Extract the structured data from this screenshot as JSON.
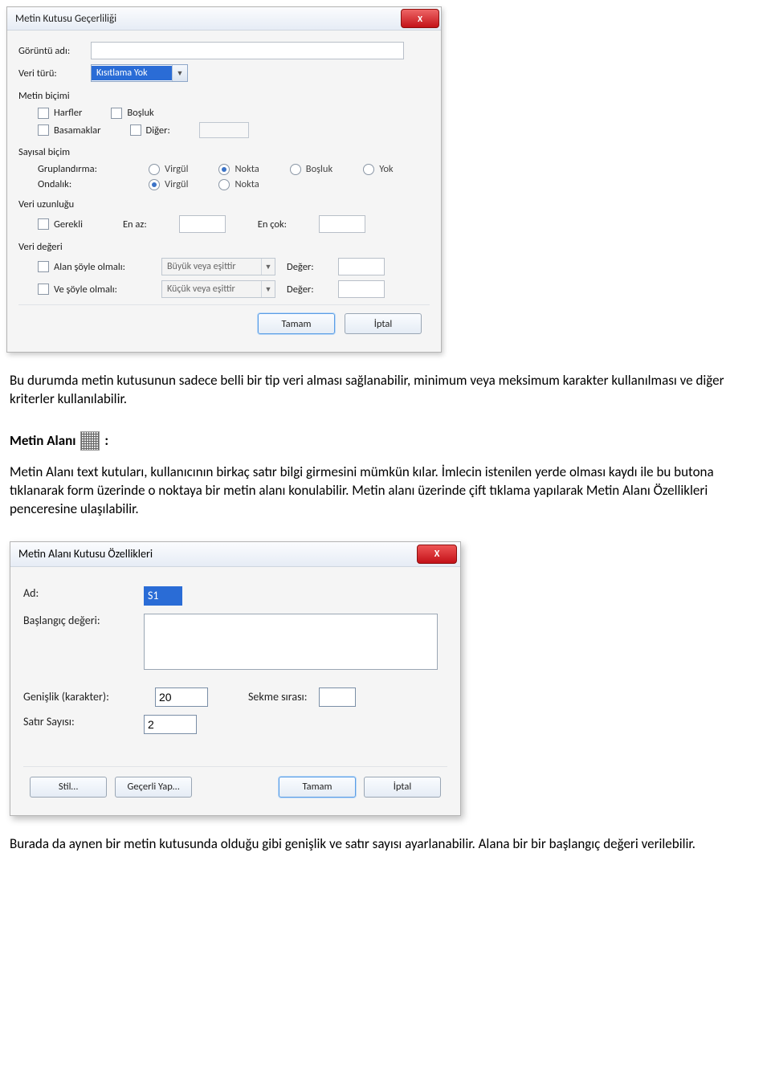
{
  "dialog1": {
    "title": "Metin Kutusu Geçerliliği",
    "close_label": "X",
    "goruntu_adi_label": "Görüntü adı:",
    "goruntu_adi_value": "",
    "veri_turu_label": "Veri türü:",
    "veri_turu_value": "Kısıtlama Yok",
    "metin_bicimi_label": "Metin biçimi",
    "chk_harfler": "Harfler",
    "chk_bosluk": "Boşluk",
    "chk_basamaklar": "Basamaklar",
    "chk_diger": "Diğer:",
    "sayisal_bicim_label": "Sayısal biçim",
    "gruplandirma_label": "Gruplandırma:",
    "ondalik_label": "Ondalık:",
    "rad_virgul": "Virgül",
    "rad_nokta": "Nokta",
    "rad_bosluk": "Boşluk",
    "rad_yok": "Yok",
    "veri_uzunlugu_label": "Veri uzunluğu",
    "chk_gerekli": "Gerekli",
    "en_az_label": "En az:",
    "en_cok_label": "En çok:",
    "veri_degeri_label": "Veri değeri",
    "chk_alan_soyle": "Alan şöyle olmalı:",
    "alan_soyle_value": "Büyük veya eşittir",
    "chk_ve_soyle": "Ve şöyle olmalı:",
    "ve_soyle_value": "Küçük veya eşittir",
    "deger_label": "Değer:",
    "btn_tamam": "Tamam",
    "btn_iptal": "İptal"
  },
  "paragraph1": "Bu durumda metin kutusunun sadece belli bir tip veri alması sağlanabilir, minimum veya meksimum karakter kullanılması  ve diğer kriterler kullanılabilir.",
  "metin_alani_heading": "Metin Alanı",
  "metin_alani_colon": ":",
  "paragraph2": "Metin Alanı text kutuları, kullanıcının birkaç satır bilgi girmesini mümkün kılar. İmlecin istenilen yerde olması kaydı ile bu butona tıklanarak form üzerinde o noktaya bir metin alanı konulabilir. Metin alanı üzerinde çift tıklama yapılarak Metin Alanı Özellikleri penceresine ulaşılabilir.",
  "dialog2": {
    "title": "Metin Alanı Kutusu Özellikleri",
    "close_label": "X",
    "ad_label": "Ad:",
    "ad_value": "S1",
    "baslangic_label": "Başlangıç değeri:",
    "baslangic_value": "",
    "genislik_label": "Genişlik (karakter):",
    "genislik_value": "20",
    "sekme_label": "Sekme sırası:",
    "sekme_value": "",
    "satir_label": "Satır Sayısı:",
    "satir_value": "2",
    "btn_stil": "Stil…",
    "btn_gecerli": "Geçerli Yap…",
    "btn_tamam": "Tamam",
    "btn_iptal": "İptal"
  },
  "paragraph3": "Burada da aynen bir metin kutusunda olduğu gibi genişlik ve satır sayısı ayarlanabilir. Alana bir bir başlangıç değeri verilebilir."
}
